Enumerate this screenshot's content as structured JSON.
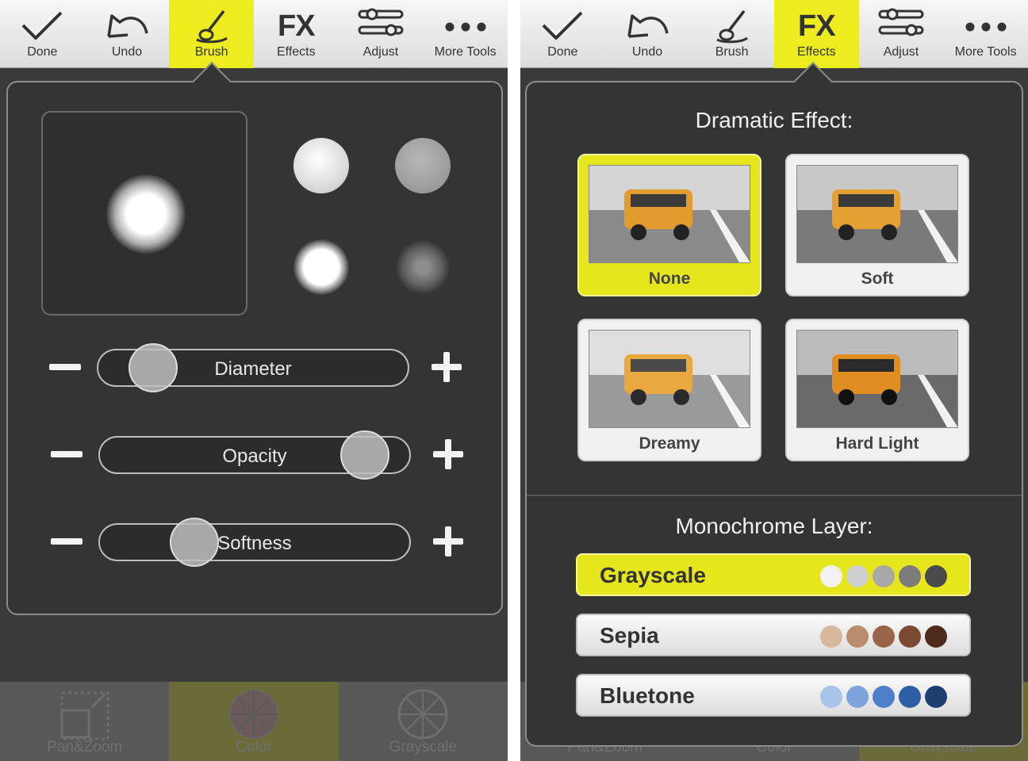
{
  "left": {
    "toolbar": [
      {
        "label": "Done",
        "icon": "checkmark-icon",
        "active": false
      },
      {
        "label": "Undo",
        "icon": "undo-icon",
        "active": false
      },
      {
        "label": "Brush",
        "icon": "brush-icon",
        "active": true
      },
      {
        "label": "Effects",
        "icon": "fx-icon",
        "glyph": "FX",
        "active": false
      },
      {
        "label": "Adjust",
        "icon": "sliders-icon",
        "active": false
      },
      {
        "label": "More Tools",
        "icon": "more-icon",
        "active": false
      }
    ],
    "sliders": [
      {
        "label": "Diameter",
        "value": 0.12
      },
      {
        "label": "Opacity",
        "value": 0.92
      },
      {
        "label": "Softness",
        "value": 0.27
      }
    ],
    "bottombar": [
      {
        "label": "Pan&Zoom",
        "icon": "pan-zoom-icon"
      },
      {
        "label": "Color",
        "icon": "color-wheel-icon"
      },
      {
        "label": "Grayscale",
        "icon": "grayscale-wheel-icon"
      }
    ]
  },
  "right": {
    "toolbar": [
      {
        "label": "Done",
        "icon": "checkmark-icon",
        "active": false
      },
      {
        "label": "Undo",
        "icon": "undo-icon",
        "active": false
      },
      {
        "label": "Brush",
        "icon": "brush-icon",
        "active": false
      },
      {
        "label": "Effects",
        "icon": "fx-icon",
        "glyph": "FX",
        "active": true
      },
      {
        "label": "Adjust",
        "icon": "sliders-icon",
        "active": false
      },
      {
        "label": "More Tools",
        "icon": "more-icon",
        "active": false
      }
    ],
    "dramatic_title": "Dramatic Effect:",
    "effects": [
      {
        "label": "None",
        "selected": true
      },
      {
        "label": "Soft",
        "selected": false
      },
      {
        "label": "Dreamy",
        "selected": false
      },
      {
        "label": "Hard Light",
        "selected": false
      }
    ],
    "mono_title": "Monochrome Layer:",
    "mono": [
      {
        "label": "Grayscale",
        "selected": true,
        "swatches": [
          "#f2f2f2",
          "#cfcfcf",
          "#a8a8a8",
          "#7c7c7c",
          "#4a4a4a"
        ]
      },
      {
        "label": "Sepia",
        "selected": false,
        "swatches": [
          "#d8b89a",
          "#b98c6c",
          "#9a6448",
          "#7a4a32",
          "#4e2c1c"
        ]
      },
      {
        "label": "Bluetone",
        "selected": false,
        "swatches": [
          "#a9c4ea",
          "#7ea3dc",
          "#4d80c8",
          "#2e5fa6",
          "#1f3f72"
        ]
      }
    ],
    "bottombar": [
      {
        "label": "Pan&Zoom"
      },
      {
        "label": "Color"
      },
      {
        "label": "Grayscale"
      }
    ]
  },
  "colors": {
    "accent_yellow": "#ecec1e",
    "panel": "#343434",
    "background": "#3a3a3a"
  }
}
